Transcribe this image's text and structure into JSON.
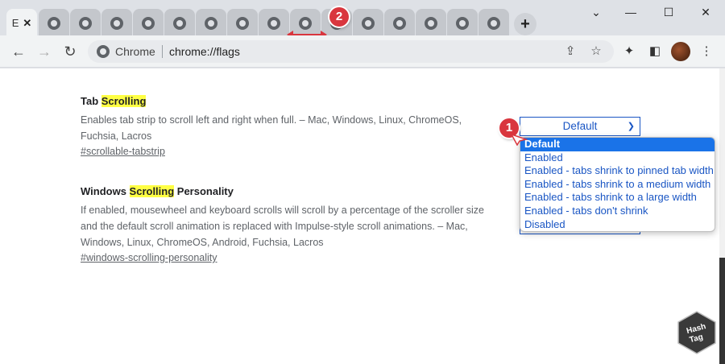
{
  "window": {
    "active_tab_letter": "E",
    "tab_count_inactive": 15,
    "controls": {
      "minimize": "⌄",
      "min": "—",
      "max": "☐",
      "close": "✕"
    }
  },
  "toolbar": {
    "omnibox_chip": "Chrome",
    "url": "chrome://flags"
  },
  "flags": [
    {
      "title_before": "Tab ",
      "title_highlight": "Scrolling",
      "title_after": "",
      "description_lines": [
        "Enables tab strip to scroll left and right when full. – Mac, Windows, Linux, ChromeOS,",
        "Fuchsia, Lacros"
      ],
      "link": "#scrollable-tabstrip",
      "select_value": "Default"
    },
    {
      "title_before": "Windows ",
      "title_highlight": "Scrolling",
      "title_after": " Personality",
      "description_lines": [
        "If enabled, mousewheel and keyboard scrolls will scroll by a percentage of the scroller size",
        "and the default scroll animation is replaced with Impulse-style scroll animations. – Mac,",
        "Windows, Linux, ChromeOS, Android, Fuchsia, Lacros"
      ],
      "link": "#windows-scrolling-personality"
    }
  ],
  "dropdown_options": [
    "Default",
    "Enabled",
    "Enabled - tabs shrink to pinned tab width",
    "Enabled - tabs shrink to a medium width",
    "Enabled - tabs shrink to a large width",
    "Enabled - tabs don't shrink",
    "Disabled"
  ],
  "annotations": {
    "badge1": "1",
    "badge2": "2"
  },
  "colors": {
    "accent": "#1a73e8",
    "highlight": "#ffff44",
    "badge": "#d9363e"
  }
}
